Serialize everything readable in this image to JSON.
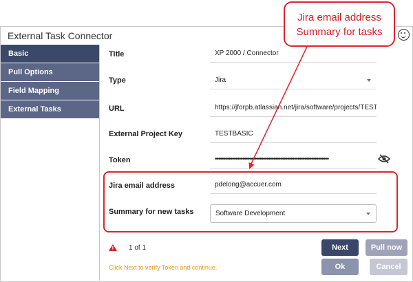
{
  "window": {
    "title": "External Task Connector"
  },
  "sidebar": {
    "items": [
      {
        "label": "Basic"
      },
      {
        "label": "Pull Options"
      },
      {
        "label": "Field Mapping"
      },
      {
        "label": "External Tasks"
      }
    ]
  },
  "form": {
    "title_label": "Title",
    "title_value": "XP 2000 / Connector",
    "type_label": "Type",
    "type_value": "Jira",
    "url_label": "URL",
    "url_value": "https://jforpb.atlassian.net/jira/software/projects/TESTBASIC",
    "project_key_label": "External Project Key",
    "project_key_value": "TESTBASIC",
    "token_label": "Token",
    "token_value": "••••••••••••••••••••••••••••••••••••••••••••••••••••••••••••••••••",
    "email_label": "Jira email address",
    "email_value": "pdelong@accuer.com",
    "summary_label": "Summary for new tasks",
    "summary_value": "Software Development"
  },
  "footer": {
    "page_count": "1 of 1",
    "hint": "Click Next to verify Token and continue.",
    "next_label": "Next",
    "pull_label": "Pull now",
    "ok_label": "Ok",
    "cancel_label": "Cancel"
  },
  "callout": {
    "line1": "Jira email address",
    "line2": "Summary for tasks"
  },
  "colors": {
    "sidebar_active": "#3c4867",
    "sidebar": "#5c6787",
    "accent_red": "#e2222b",
    "hint_orange": "#e69a1a"
  }
}
